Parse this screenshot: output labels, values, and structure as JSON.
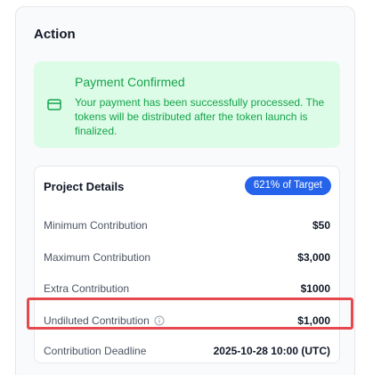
{
  "action": {
    "title": "Action"
  },
  "alert": {
    "icon": "credit-card-icon",
    "title": "Payment Confirmed",
    "message": "Your payment has been successfully processed. The tokens will be distributed after the token launch is finalized.",
    "color": "#16a34a",
    "background": "#dcfce7"
  },
  "project": {
    "title": "Project Details",
    "badge": "621% of Target",
    "badge_color": "#2563eb",
    "rows": [
      {
        "label": "Minimum Contribution",
        "value": "$50"
      },
      {
        "label": "Maximum Contribution",
        "value": "$3,000"
      },
      {
        "label": "Extra Contribution",
        "value": "$1000"
      },
      {
        "label": "Undiluted Contribution",
        "value": "$1,000",
        "icon": "info-icon"
      },
      {
        "label": "Contribution Deadline",
        "value": "2025-10-28 10:00 (UTC)"
      }
    ]
  },
  "highlight_color": "#e5484d"
}
